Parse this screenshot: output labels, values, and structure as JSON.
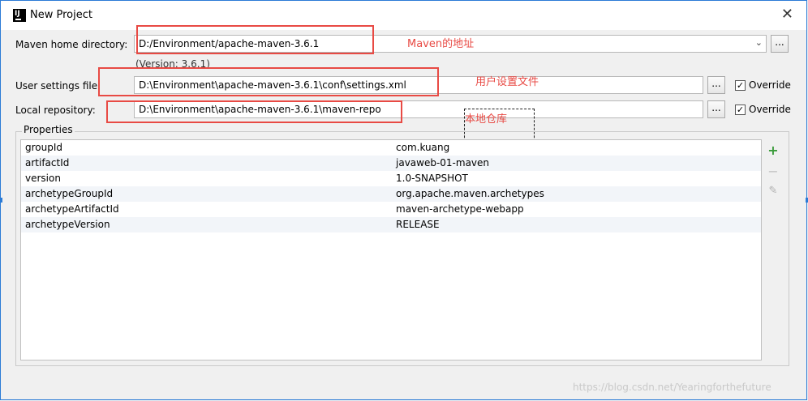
{
  "window": {
    "title": "New Project",
    "close_symbol": "✕"
  },
  "fields": {
    "maven_home": {
      "label": "Maven home directory:",
      "value": "D:/Environment/apache-maven-3.6.1",
      "version": "(Version: 3.6.1)"
    },
    "user_settings": {
      "label": "User settings file:",
      "value": "D:\\Environment\\apache-maven-3.6.1\\conf\\settings.xml",
      "override": "Override"
    },
    "local_repo": {
      "label": "Local repository:",
      "value": "D:\\Environment\\apache-maven-3.6.1\\maven-repo",
      "override": "Override"
    },
    "browse_label": "..."
  },
  "annotations": {
    "maven_home": "Maven的地址",
    "user_settings": "用户设置文件",
    "local_repo": "本地仓库"
  },
  "properties": {
    "title": "Properties",
    "rows": [
      {
        "key": "groupId",
        "value": "com.kuang"
      },
      {
        "key": "artifactId",
        "value": "javaweb-01-maven"
      },
      {
        "key": "version",
        "value": "1.0-SNAPSHOT"
      },
      {
        "key": "archetypeGroupId",
        "value": "org.apache.maven.archetypes"
      },
      {
        "key": "archetypeArtifactId",
        "value": "maven-archetype-webapp"
      },
      {
        "key": "archetypeVersion",
        "value": "RELEASE"
      }
    ]
  },
  "watermark": "https://blog.csdn.net/Yearingforthefuture",
  "colors": {
    "annotation": "#e84a44",
    "add": "#3a9b3a",
    "border": "#2b7bd6"
  }
}
